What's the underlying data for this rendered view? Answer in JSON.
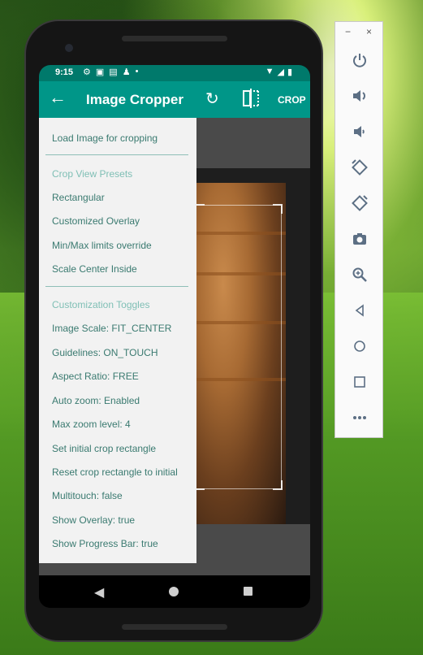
{
  "status_bar": {
    "time": "9:15",
    "left_icons": [
      "gear-icon",
      "shield-icon",
      "image-icon",
      "person-icon",
      "dot-icon"
    ],
    "right_icons": [
      "wifi-icon",
      "signal-icon",
      "battery-icon"
    ]
  },
  "app_bar": {
    "title": "Image Cropper",
    "crop_label": "CROP",
    "accent": "#009688",
    "status_color": "#00796b"
  },
  "drawer": {
    "load_item": "Load Image for cropping",
    "presets_header": "Crop View Presets",
    "presets": [
      "Rectangular",
      "Customized Overlay",
      "Min/Max limits override",
      "Scale Center Inside"
    ],
    "toggles_header": "Customization Toggles",
    "toggles": [
      "Image Scale: FIT_CENTER",
      "Guidelines: ON_TOUCH",
      "Aspect Ratio: FREE",
      "Auto zoom: Enabled",
      "Max zoom level: 4",
      "Set initial crop rectangle",
      "Reset crop rectangle to initial",
      "Multitouch: false",
      "Show Overlay: true",
      "Show Progress Bar: true"
    ],
    "text_color": "#3a7a70",
    "header_color": "#7fbfb5"
  },
  "nav_bar": {
    "icons": [
      "back-icon",
      "home-icon",
      "recent-apps-icon"
    ]
  },
  "emulator_toolbar": {
    "window_controls": [
      "−",
      "×"
    ],
    "buttons": [
      "power-icon",
      "volume-up-icon",
      "volume-down-icon",
      "rotate-left-icon",
      "rotate-right-icon",
      "camera-icon",
      "zoom-icon",
      "back-icon",
      "home-icon",
      "overview-icon",
      "more-icon"
    ]
  }
}
